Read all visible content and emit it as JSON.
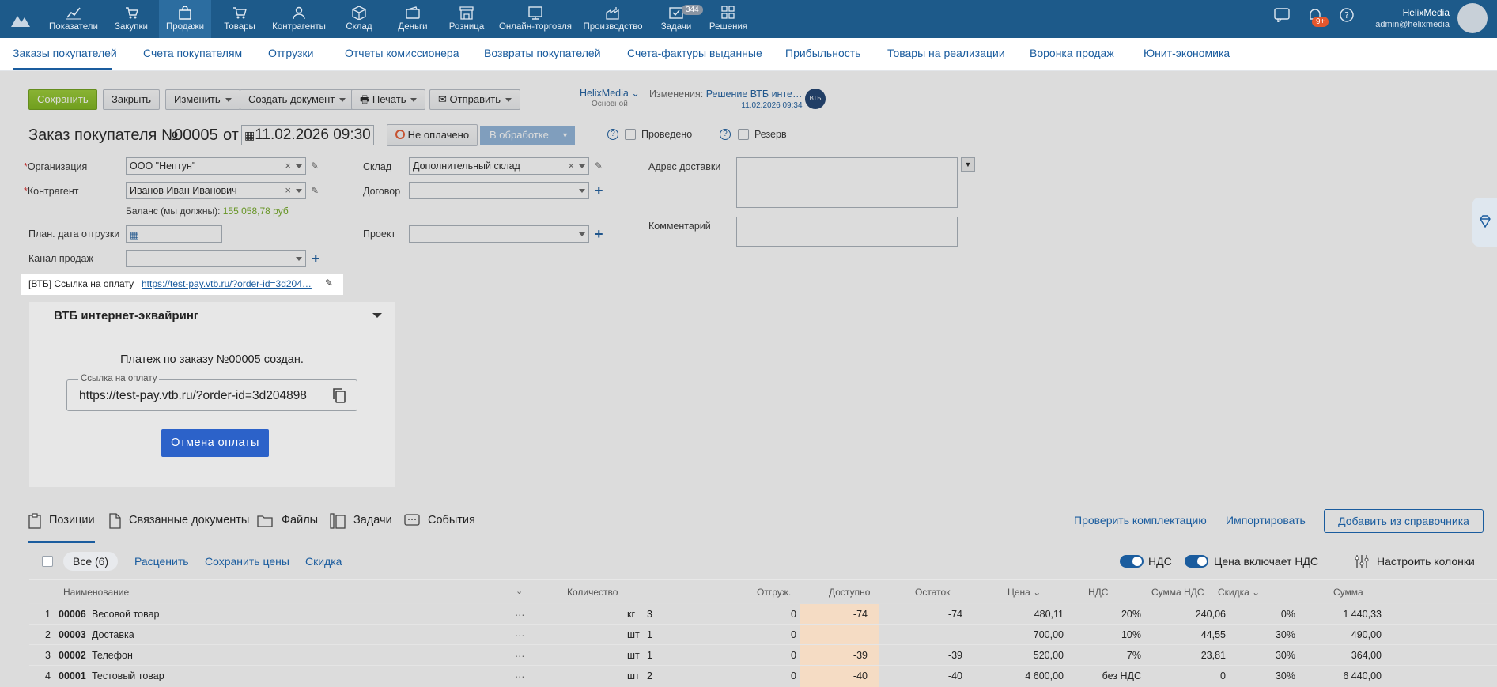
{
  "topnav": {
    "items": [
      {
        "label": "Показатели",
        "icon": "chart-line-icon"
      },
      {
        "label": "Закупки",
        "icon": "cart-arrow-icon"
      },
      {
        "label": "Продажи",
        "icon": "bag-icon",
        "active": true
      },
      {
        "label": "Товары",
        "icon": "cart-icon"
      },
      {
        "label": "Контрагенты",
        "icon": "people-icon"
      },
      {
        "label": "Склад",
        "icon": "box-icon"
      },
      {
        "label": "Деньги",
        "icon": "wallet-icon"
      },
      {
        "label": "Розница",
        "icon": "store-icon"
      },
      {
        "label": "Онлайн-торговля",
        "icon": "online-store-icon"
      },
      {
        "label": "Производство",
        "icon": "factory-icon"
      },
      {
        "label": "Задачи",
        "icon": "tasks-icon",
        "badge": "344"
      },
      {
        "label": "Решения",
        "icon": "apps-icon"
      }
    ],
    "notifications_badge": "9+",
    "user_name": "HelixMedia",
    "user_email": "admin@helixmedia"
  },
  "subnav": [
    "Заказы покупателей",
    "Счета покупателям",
    "Отгрузки",
    "Отчеты комиссионера",
    "Возвраты покупателей",
    "Счета-фактуры выданные",
    "Прибыльность",
    "Товары на реализации",
    "Воронка продаж",
    "Юнит-экономика"
  ],
  "toolbar": {
    "save": "Сохранить",
    "close": "Закрыть",
    "edit": "Изменить",
    "create_doc": "Создать документ",
    "print": "Печать",
    "send": "Отправить",
    "org_name": "HelixMedia",
    "org_sub": "Основной",
    "changes_label": "Изменения:",
    "changes_value": "Решение ВТБ инте…",
    "changes_date": "11.02.2026 09:34",
    "vtb_badge": "ВТБ"
  },
  "doc": {
    "title": "Заказ покупателя №",
    "number": "00005",
    "from": "от",
    "date": "11.02.2026 09:30",
    "payment_status": "Не оплачено",
    "status": "В обработке",
    "posted": "Проведено",
    "reserve": "Резерв"
  },
  "form": {
    "org_label": "Организация",
    "org_value": "ООО \"Нептун\"",
    "contractor_label": "Контрагент",
    "contractor_value": "Иванов Иван Иванович",
    "balance_label": "Баланс (мы должны):",
    "balance_value": "155 058,78 руб",
    "ship_date_label": "План. дата отгрузки",
    "channel_label": "Канал продаж",
    "warehouse_label": "Склад",
    "warehouse_value": "Дополнительный склад",
    "contract_label": "Договор",
    "project_label": "Проект",
    "address_label": "Адрес доставки",
    "comment_label": "Комментарий",
    "pay_link_label": "[ВТБ] Ссылка на оплату",
    "pay_link_value": "https://test-pay.vtb.ru/?order-id=3d204…"
  },
  "vtb": {
    "title": "ВТБ интернет-эквайринг",
    "message": "Платеж по заказу №00005 создан.",
    "link_legend": "Ссылка на оплату",
    "link_value": "https://test-pay.vtb.ru/?order-id=3d204898",
    "cancel": "Отмена оплаты"
  },
  "bottom_tabs": [
    "Позиции",
    "Связанные документы",
    "Файлы",
    "Задачи",
    "События"
  ],
  "bottom_actions": {
    "check": "Проверить комплектацию",
    "import": "Импортировать",
    "add": "Добавить из справочника"
  },
  "list_toolbar": {
    "all": "Все (6)",
    "price": "Расценить",
    "save_prices": "Сохранить цены",
    "discount": "Скидка",
    "vat": "НДС",
    "price_incl_vat": "Цена включает НДС",
    "columns": "Настроить колонки"
  },
  "columns": [
    "Наименование",
    "Количество",
    "Отгруж.",
    "Доступно",
    "Остаток",
    "Цена",
    "НДС",
    "Сумма НДС",
    "Скидка",
    "Сумма"
  ],
  "rows": [
    {
      "n": "1",
      "code": "00006",
      "name": "Весовой товар",
      "qty": "3",
      "unit": "кг",
      "shipped": "0",
      "avail": "-74",
      "rest": "-74",
      "price": "480,11",
      "vat": "20%",
      "vat_sum": "240,06",
      "disc": "0%",
      "sum": "1 440,33"
    },
    {
      "n": "2",
      "code": "00003",
      "name": "Доставка",
      "qty": "1",
      "unit": "шт",
      "shipped": "0",
      "avail": "",
      "rest": "",
      "price": "700,00",
      "vat": "10%",
      "vat_sum": "44,55",
      "disc": "30%",
      "sum": "490,00"
    },
    {
      "n": "3",
      "code": "00002",
      "name": "Телефон",
      "qty": "1",
      "unit": "шт",
      "shipped": "0",
      "avail": "-39",
      "rest": "-39",
      "price": "520,00",
      "vat": "7%",
      "vat_sum": "23,81",
      "disc": "30%",
      "sum": "364,00"
    },
    {
      "n": "4",
      "code": "00001",
      "name": "Тестовый товар",
      "qty": "2",
      "unit": "шт",
      "shipped": "0",
      "avail": "-40",
      "rest": "-40",
      "price": "4 600,00",
      "vat": "без НДС",
      "vat_sum": "0",
      "disc": "30%",
      "sum": "6 440,00"
    }
  ]
}
